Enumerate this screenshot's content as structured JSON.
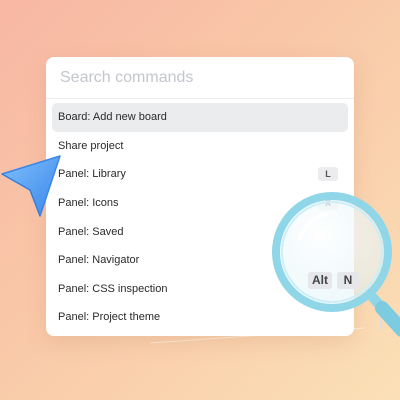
{
  "search": {
    "placeholder": "Search commands"
  },
  "commands": [
    {
      "label": "Board: Add new board",
      "selected": true,
      "keys": []
    },
    {
      "label": "Share project",
      "keys": []
    },
    {
      "label": "Panel: Library",
      "keys": [
        "L"
      ]
    },
    {
      "label": "Panel: Icons",
      "keys": [
        "X"
      ]
    },
    {
      "label": "Panel: Saved",
      "keys": []
    },
    {
      "label": "Panel: Navigator",
      "keys": []
    },
    {
      "label": "Panel: CSS inspection",
      "keys": [
        "Alt",
        "N"
      ]
    },
    {
      "label": "Panel: Project theme",
      "keys": []
    }
  ],
  "colors": {
    "cursor": "#4a9ef5",
    "magnifier_rim": "#8fd6e8",
    "selected_row": "#ebecee"
  }
}
